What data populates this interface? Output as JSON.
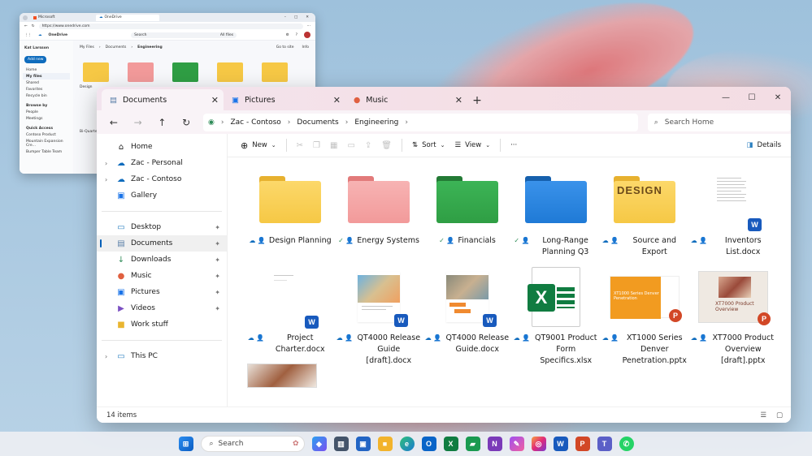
{
  "browser": {
    "tabs": [
      {
        "label": "Microsoft"
      },
      {
        "label": "OneDrive"
      }
    ],
    "url": "https://www.onedrive.com",
    "app_name": "OneDrive",
    "search_placeholder": "Search",
    "search_scope": "All files",
    "user_name": "Kat Larsson",
    "add_new": "Add new",
    "nav": [
      "Home",
      "My files",
      "Shared",
      "Favorites",
      "Recycle bin"
    ],
    "browse_by": "Browse by",
    "browse_items": [
      "People",
      "Meetings"
    ],
    "quick_access": "Quick Access",
    "quick_items": [
      "Contoso Product",
      "Mountain Expansion Cre...",
      "Bumper Table Team"
    ],
    "breadcrumb": [
      "My Files",
      "Documents",
      "Engineering"
    ],
    "actions": [
      "Go to site",
      "Info"
    ],
    "partial_labels": [
      "Design",
      "Bi-Quarterly"
    ]
  },
  "explorer": {
    "tabs": [
      {
        "label": "Documents",
        "icon": "documents-icon"
      },
      {
        "label": "Pictures",
        "icon": "pictures-icon"
      },
      {
        "label": "Music",
        "icon": "music-icon"
      }
    ],
    "address": [
      "Zac - Contoso",
      "Documents",
      "Engineering"
    ],
    "search_placeholder": "Search Home",
    "toolbar": {
      "new": "New",
      "sort": "Sort",
      "view": "View",
      "more": "···",
      "details": "Details"
    },
    "sidebar": {
      "top": [
        {
          "label": "Home",
          "icon": "home-icon",
          "chevron": false
        },
        {
          "label": "Zac - Personal",
          "icon": "onedrive-cloud-icon",
          "chevron": true
        },
        {
          "label": "Zac - Contoso",
          "icon": "onedrive-cloud-icon",
          "chevron": true
        },
        {
          "label": "Gallery",
          "icon": "gallery-icon",
          "chevron": false
        }
      ],
      "pinned": [
        {
          "label": "Desktop",
          "icon": "desktop-icon",
          "pinned": true
        },
        {
          "label": "Documents",
          "icon": "documents-icon",
          "pinned": true,
          "selected": true
        },
        {
          "label": "Downloads",
          "icon": "downloads-icon",
          "pinned": true
        },
        {
          "label": "Music",
          "icon": "music-icon",
          "pinned": true
        },
        {
          "label": "Pictures",
          "icon": "pictures-icon",
          "pinned": true
        },
        {
          "label": "Videos",
          "icon": "videos-icon",
          "pinned": true
        },
        {
          "label": "Work stuff",
          "icon": "folder-icon",
          "pinned": false
        }
      ],
      "bottom": [
        {
          "label": "This PC",
          "icon": "this-pc-icon",
          "chevron": true
        }
      ]
    },
    "files": [
      {
        "name": "Design Planning",
        "kind": "folder",
        "color": "#f6c845",
        "status": "cloud"
      },
      {
        "name": "Energy Systems",
        "kind": "folder",
        "color": "#f29a9a",
        "status": "synced"
      },
      {
        "name": "Financials",
        "kind": "folder",
        "color": "#2f9e44",
        "status": "synced"
      },
      {
        "name": "Long-Range Planning Q3",
        "kind": "folder",
        "color": "#1f7ad6",
        "status": "synced"
      },
      {
        "name": "Source and Export",
        "kind": "folder-design",
        "color": "#f6c845",
        "status": "cloud",
        "thumb_text": "DESIGN"
      },
      {
        "name": "Inventors List.docx",
        "kind": "word",
        "status": "cloud"
      },
      {
        "name": "Project Charter.docx",
        "kind": "word",
        "status": "cloud"
      },
      {
        "name": "QT4000 Release Guide [draft].docx",
        "kind": "word-photo",
        "status": "cloud"
      },
      {
        "name": "QT4000 Release Guide.docx",
        "kind": "word-photo",
        "status": "cloud"
      },
      {
        "name": "QT9001 Product Form Specifics.xlsx",
        "kind": "excel",
        "status": "cloud"
      },
      {
        "name": "XT1000 Series Denver Penetration.pptx",
        "kind": "ppt-orange",
        "status": "cloud",
        "thumb_text": "XT1000 Series Denver Penetration"
      },
      {
        "name": "XT7000 Product Overview [draft].pptx",
        "kind": "ppt-photo",
        "status": "cloud",
        "thumb_text": "XT7000 Product Overview"
      }
    ],
    "status": "14 items"
  },
  "taskbar": {
    "search_placeholder": "Search",
    "apps": [
      "copilot-icon",
      "task-view-icon",
      "store-icon",
      "file-explorer-icon",
      "edge-icon",
      "outlook-icon",
      "excel-icon",
      "onenote-icon",
      "loop-icon",
      "designer-icon",
      "instagram-icon",
      "word-icon",
      "powerpoint-icon",
      "teams-icon",
      "whatsapp-icon"
    ]
  }
}
